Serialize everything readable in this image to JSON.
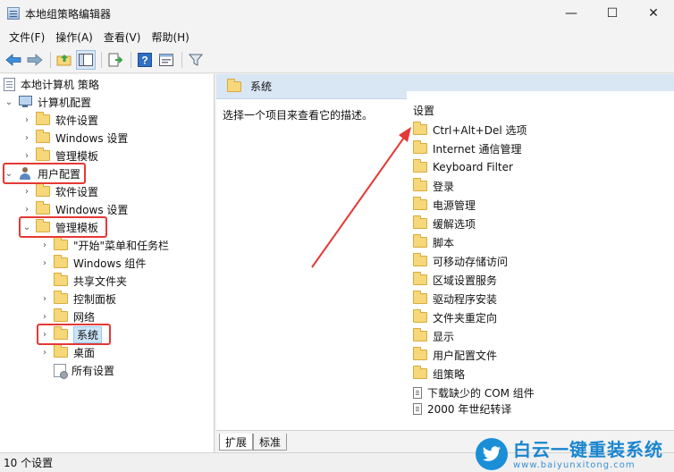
{
  "window": {
    "title": "本地组策略编辑器",
    "controls": {
      "minimize": "—",
      "maximize": "☐",
      "close": "✕"
    }
  },
  "menu": [
    "文件(F)",
    "操作(A)",
    "查看(V)",
    "帮助(H)"
  ],
  "toolbar": [
    "back-icon",
    "forward-icon",
    "up-folder-icon",
    "show-hide-tree-icon",
    "export-list-icon",
    "help-icon",
    "properties-icon",
    "filter-icon"
  ],
  "tree": {
    "root": "本地计算机 策略",
    "computer_config": "计算机配置",
    "cc_software": "软件设置",
    "cc_windows": "Windows 设置",
    "cc_admin": "管理模板",
    "user_config": "用户配置",
    "uc_software": "软件设置",
    "uc_windows": "Windows 设置",
    "uc_admin": "管理模板",
    "start_menu": "\"开始\"菜单和任务栏",
    "win_components": "Windows 组件",
    "shared_folders": "共享文件夹",
    "control_panel": "控制面板",
    "network": "网络",
    "system": "系统",
    "desktop": "桌面",
    "all_settings": "所有设置"
  },
  "details": {
    "header": "系统",
    "description": "选择一个项目来查看它的描述。",
    "column_header": "设置",
    "items": [
      "Ctrl+Alt+Del 选项",
      "Internet 通信管理",
      "Keyboard Filter",
      "登录",
      "电源管理",
      "缓解选项",
      "脚本",
      "可移动存储访问",
      "区域设置服务",
      "驱动程序安装",
      "文件夹重定向",
      "显示",
      "用户配置文件",
      "组策略",
      "下载缺少的 COM 组件",
      "2000 年世纪转译"
    ]
  },
  "tabs": {
    "extended": "扩展",
    "standard": "标准"
  },
  "status": "10 个设置",
  "watermark": {
    "brand": "白云一键重装系统",
    "url": "www.baiyunxitong.com"
  },
  "colors": {
    "highlight_box": "#e53935",
    "arrow": "#e53935",
    "header_bg": "#d9e6f4",
    "selection": "#cce4f7"
  }
}
